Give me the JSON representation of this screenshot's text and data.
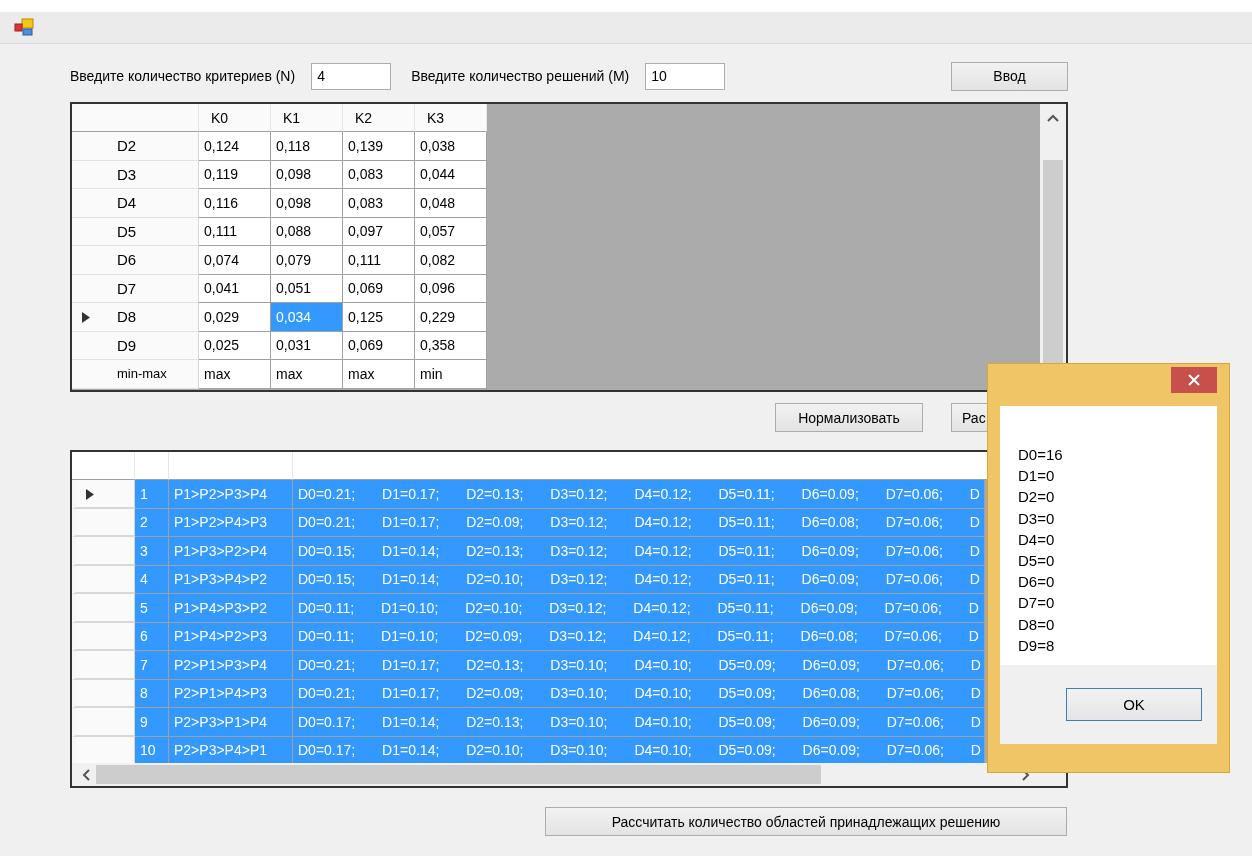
{
  "inputs": [
    {
      "label": "Введите количество критериев (N)",
      "value": "4"
    },
    {
      "label": "Введите количество решений (M)",
      "value": "10"
    }
  ],
  "enter_button": "Ввод",
  "criteria_grid": {
    "columns": [
      "K0",
      "K1",
      "K2",
      "K3"
    ],
    "rows": [
      {
        "header": "D2",
        "current": false,
        "cells": [
          {
            "text": "0,124",
            "selected": false
          },
          {
            "text": "0,118",
            "selected": false
          },
          {
            "text": "0,139",
            "selected": false
          },
          {
            "text": "0,038",
            "selected": false
          }
        ]
      },
      {
        "header": "D3",
        "current": false,
        "cells": [
          {
            "text": "0,119",
            "selected": false
          },
          {
            "text": "0,098",
            "selected": false
          },
          {
            "text": "0,083",
            "selected": false
          },
          {
            "text": "0,044",
            "selected": false
          }
        ]
      },
      {
        "header": "D4",
        "current": false,
        "cells": [
          {
            "text": "0,116",
            "selected": false
          },
          {
            "text": "0,098",
            "selected": false
          },
          {
            "text": "0,083",
            "selected": false
          },
          {
            "text": "0,048",
            "selected": false
          }
        ]
      },
      {
        "header": "D5",
        "current": false,
        "cells": [
          {
            "text": "0,111",
            "selected": false
          },
          {
            "text": "0,088",
            "selected": false
          },
          {
            "text": "0,097",
            "selected": false
          },
          {
            "text": "0,057",
            "selected": false
          }
        ]
      },
      {
        "header": "D6",
        "current": false,
        "cells": [
          {
            "text": "0,074",
            "selected": false
          },
          {
            "text": "0,079",
            "selected": false
          },
          {
            "text": "0,111",
            "selected": false
          },
          {
            "text": "0,082",
            "selected": false
          }
        ]
      },
      {
        "header": "D7",
        "current": false,
        "cells": [
          {
            "text": "0,041",
            "selected": false
          },
          {
            "text": "0,051",
            "selected": false
          },
          {
            "text": "0,069",
            "selected": false
          },
          {
            "text": "0,096",
            "selected": false
          }
        ]
      },
      {
        "header": "D8",
        "current": true,
        "cells": [
          {
            "text": "0,029",
            "selected": false
          },
          {
            "text": "0,034",
            "selected": true
          },
          {
            "text": "0,125",
            "selected": false
          },
          {
            "text": "0,229",
            "selected": false
          }
        ]
      },
      {
        "header": "D9",
        "current": false,
        "cells": [
          {
            "text": "0,025",
            "selected": false
          },
          {
            "text": "0,031",
            "selected": false
          },
          {
            "text": "0,069",
            "selected": false
          },
          {
            "text": "0,358",
            "selected": false
          }
        ]
      },
      {
        "header": "min-max",
        "current": false,
        "cells": [
          {
            "text": "max",
            "selected": false
          },
          {
            "text": "max",
            "selected": false
          },
          {
            "text": "max",
            "selected": false
          },
          {
            "text": "min",
            "selected": false
          }
        ]
      }
    ]
  },
  "action_buttons": [
    "Нормализовать",
    "Рас"
  ],
  "results_grid": {
    "rows": [
      {
        "number": "1",
        "order": "P1>P2>P3>P4",
        "values": "D0=0.21; D1=0.17; D2=0.13; D3=0.12; D4=0.12; D5=0.11; D6=0.09; D7=0.06; D",
        "selected": true,
        "current": true
      },
      {
        "number": "2",
        "order": "P1>P2>P4>P3",
        "values": "D0=0.21; D1=0.17; D2=0.09; D3=0.12; D4=0.12; D5=0.11; D6=0.08; D7=0.06; D",
        "selected": true,
        "current": false
      },
      {
        "number": "3",
        "order": "P1>P3>P2>P4",
        "values": "D0=0.15; D1=0.14; D2=0.13; D3=0.12; D4=0.12; D5=0.11; D6=0.09; D7=0.06; D",
        "selected": true,
        "current": false
      },
      {
        "number": "4",
        "order": "P1>P3>P4>P2",
        "values": "D0=0.15; D1=0.14; D2=0.10; D3=0.12; D4=0.12; D5=0.11; D6=0.09; D7=0.06; D",
        "selected": true,
        "current": false
      },
      {
        "number": "5",
        "order": "P1>P4>P3>P2",
        "values": "D0=0.11; D1=0.10; D2=0.10; D3=0.12; D4=0.12; D5=0.11; D6=0.09; D7=0.06; D",
        "selected": true,
        "current": false
      },
      {
        "number": "6",
        "order": "P1>P4>P2>P3",
        "values": "D0=0.11; D1=0.10; D2=0.09; D3=0.12; D4=0.12; D5=0.11; D6=0.08; D7=0.06; D",
        "selected": true,
        "current": false
      },
      {
        "number": "7",
        "order": "P2>P1>P3>P4",
        "values": "D0=0.21; D1=0.17; D2=0.13; D3=0.10; D4=0.10; D5=0.09; D6=0.09; D7=0.06; D",
        "selected": true,
        "current": false
      },
      {
        "number": "8",
        "order": "P2>P1>P4>P3",
        "values": "D0=0.21; D1=0.17; D2=0.09; D3=0.10; D4=0.10; D5=0.09; D6=0.08; D7=0.06; D",
        "selected": true,
        "current": false
      },
      {
        "number": "9",
        "order": "P2>P3>P1>P4",
        "values": "D0=0.17; D1=0.14; D2=0.13; D3=0.10; D4=0.10; D5=0.09; D6=0.09; D7=0.06; D",
        "selected": true,
        "current": false
      },
      {
        "number": "10",
        "order": "P2>P3>P4>P1",
        "values": "D0=0.17; D1=0.14; D2=0.10; D3=0.10; D4=0.10; D5=0.09; D6=0.09; D7=0.06; D",
        "selected": true,
        "current": false
      }
    ]
  },
  "calculate_button": "Рассчитать количество областей принадлежащих решению",
  "dialog": {
    "lines": [
      "D0=16",
      "D1=0",
      "D2=0",
      "D3=0",
      "D4=0",
      "D5=0",
      "D6=0",
      "D7=0",
      "D8=0",
      "D9=8"
    ],
    "ok_button": "OK"
  }
}
